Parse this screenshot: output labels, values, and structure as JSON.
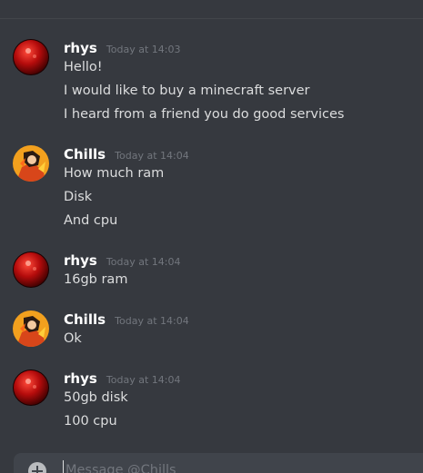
{
  "messages": [
    {
      "author": "rhys",
      "timestamp": "Today at 14:03",
      "lines": [
        "Hello!",
        "I would like to buy a minecraft server",
        "I heard from a friend you do good services"
      ]
    },
    {
      "author": "Chills",
      "timestamp": "Today at 14:04",
      "lines": [
        "How much ram",
        "Disk",
        "And cpu"
      ]
    },
    {
      "author": "rhys",
      "timestamp": "Today at 14:04",
      "lines": [
        "16gb ram"
      ]
    },
    {
      "author": "Chills",
      "timestamp": "Today at 14:04",
      "lines": [
        "Ok"
      ]
    },
    {
      "author": "rhys",
      "timestamp": "Today at 14:04",
      "lines": [
        "50gb disk",
        "100 cpu"
      ]
    }
  ],
  "composer": {
    "placeholder": "Message @Chills"
  },
  "colors": {
    "background": "#36393f",
    "composer": "#40444b",
    "username": "#ffffff",
    "timestamp": "#72767d",
    "text": "#dcddde"
  }
}
